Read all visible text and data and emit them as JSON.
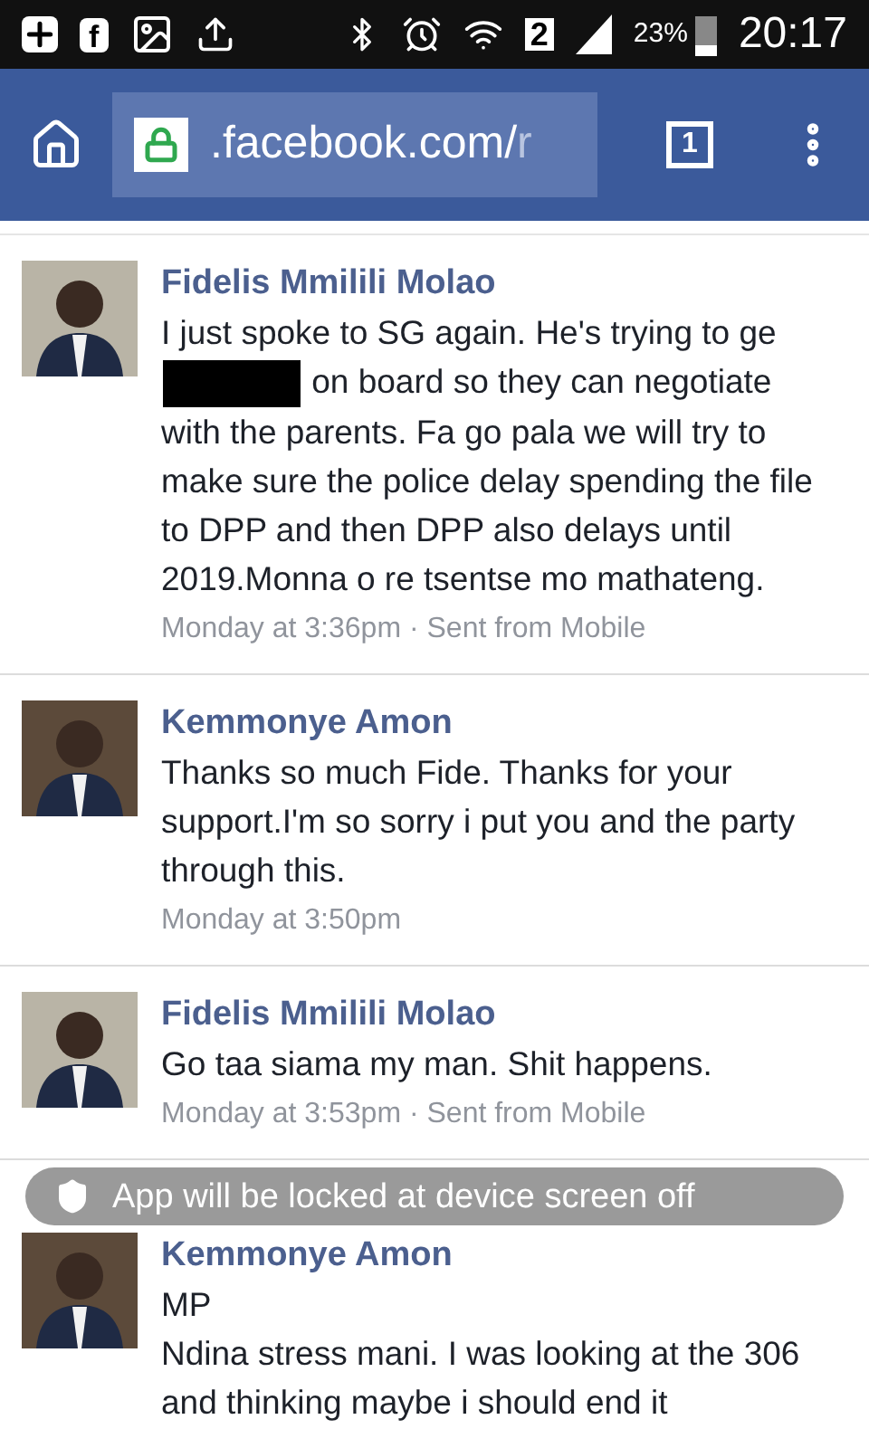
{
  "status_bar": {
    "notification_logo": "f",
    "sim_label": "2",
    "battery": "23%",
    "time": "20:17"
  },
  "browser": {
    "url": ".facebook.com/",
    "url_faded": "r",
    "tab_count": "1"
  },
  "messages": [
    {
      "sender": "Fidelis Mmilili Molao",
      "paragraphs": [
        {
          "before": "I just spoke to SG again. He's trying to ge",
          "redacted": true,
          "after": "on board so they can negotiate with the parents. Fa go pala we will try to make sure the police delay spending the file to DPP and then DPP also delays until 2019.Monna o re tsentse mo mathateng."
        }
      ],
      "time": "Monday at 3:36pm · Sent from Mobile"
    },
    {
      "sender": "Kemmonye Amon",
      "paragraphs": [
        {
          "before": "Thanks so much Fide. Thanks for your support.I'm so sorry i put you and the party through this.",
          "redacted": false
        }
      ],
      "time": "Monday at 3:50pm"
    },
    {
      "sender": "Fidelis Mmilili Molao",
      "paragraphs": [
        {
          "before": "Go taa siama my man. Shit happens.",
          "redacted": false
        }
      ],
      "time": "Monday at 3:53pm · Sent from Mobile"
    },
    {
      "sender": "Kemmonye Amon",
      "paragraphs": [
        {
          "before": "MP",
          "redacted": false
        },
        {
          "before": "Ndina stress mani. I was looking at the 306 and thinking maybe i should end it",
          "redacted": false
        }
      ]
    }
  ],
  "toast": {
    "text": "App will be locked at device screen off"
  }
}
